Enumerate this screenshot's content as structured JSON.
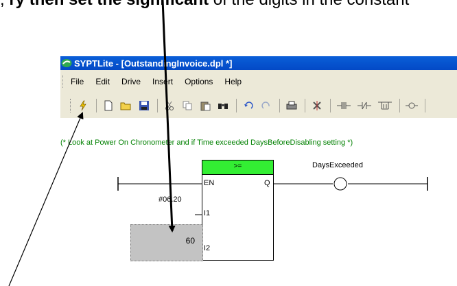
{
  "top_text": {
    "before": ", ",
    "bold": "ry then set the significant ",
    "after": "of the digits in the constant"
  },
  "window": {
    "title": "SYPTLite - [OutstandingInvoice.dpl *]",
    "menu": [
      "File",
      "Edit",
      "Drive",
      "Insert",
      "Options",
      "Help"
    ],
    "toolbar_icons": [
      "lightning-icon",
      "new-file-icon",
      "open-folder-icon",
      "save-icon",
      "cut-icon",
      "copy-icon",
      "paste-icon",
      "find-icon",
      "undo-icon",
      "redo-icon",
      "print-icon",
      "compile-icon",
      "contact-icon",
      "coil-icon"
    ]
  },
  "ladder": {
    "comment": "(* Look at Power On Chronometer and if Time exceeded DaysBeforeDisabling setting *)",
    "block_op": ">=",
    "pin_en": "EN",
    "pin_q": "Q",
    "pin_i1": "I1",
    "pin_i2": "I2",
    "param_label": "#06.20",
    "constant_value": "60",
    "coil_label": "DaysExceeded"
  }
}
